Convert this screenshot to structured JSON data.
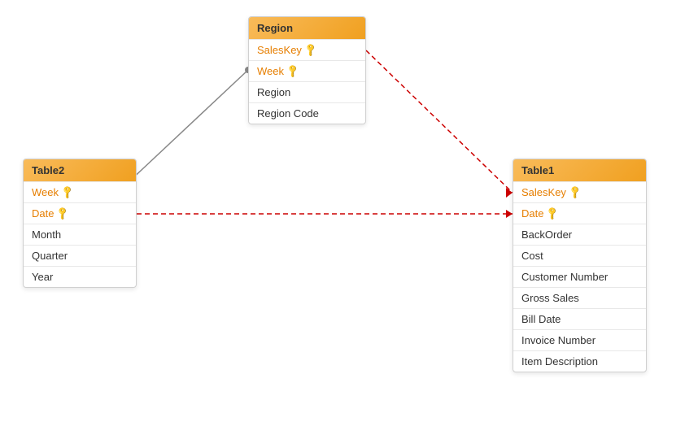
{
  "tables": {
    "table2": {
      "title": "Table2",
      "fields": [
        {
          "name": "Week",
          "isKey": true
        },
        {
          "name": "Date",
          "isKey": true
        },
        {
          "name": "Month",
          "isKey": false
        },
        {
          "name": "Quarter",
          "isKey": false
        },
        {
          "name": "Year",
          "isKey": false
        }
      ]
    },
    "region": {
      "title": "Region",
      "fields": [
        {
          "name": "SalesKey",
          "isKey": true
        },
        {
          "name": "Week",
          "isKey": true
        },
        {
          "name": "Region",
          "isKey": false
        },
        {
          "name": "Region Code",
          "isKey": false
        }
      ]
    },
    "table1": {
      "title": "Table1",
      "fields": [
        {
          "name": "SalesKey",
          "isKey": true
        },
        {
          "name": "Date",
          "isKey": true
        },
        {
          "name": "BackOrder",
          "isKey": false
        },
        {
          "name": "Cost",
          "isKey": false
        },
        {
          "name": "Customer Number",
          "isKey": false
        },
        {
          "name": "Gross Sales",
          "isKey": false
        },
        {
          "name": "Bill Date",
          "isKey": false
        },
        {
          "name": "Invoice Number",
          "isKey": false
        },
        {
          "name": "Item Description",
          "isKey": false
        }
      ]
    }
  }
}
